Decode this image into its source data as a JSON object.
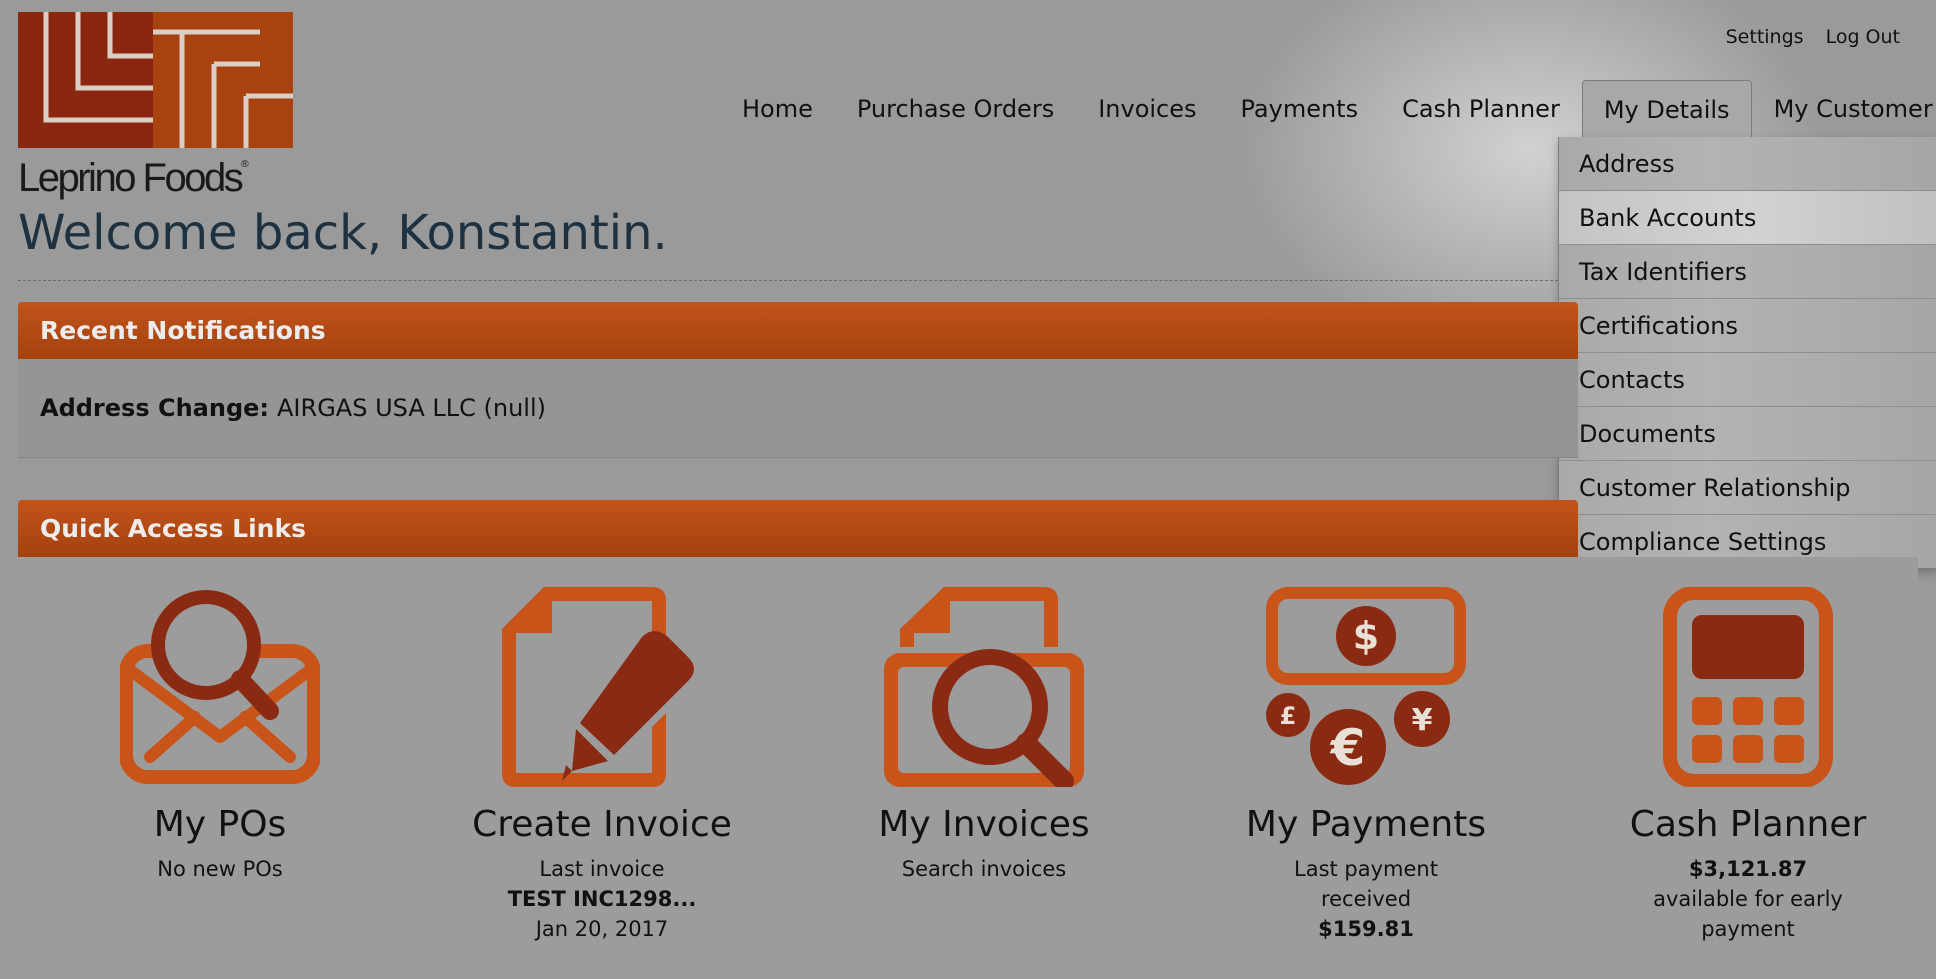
{
  "brand": {
    "name": "Leprino Foods",
    "mark": "®"
  },
  "util_nav": {
    "settings": "Settings",
    "logout": "Log Out"
  },
  "main_nav": [
    {
      "label": "Home"
    },
    {
      "label": "Purchase Orders"
    },
    {
      "label": "Invoices"
    },
    {
      "label": "Payments"
    },
    {
      "label": "Cash Planner"
    },
    {
      "label": "My Details"
    },
    {
      "label": "My Customer"
    }
  ],
  "dropdown": [
    {
      "label": "Address"
    },
    {
      "label": "Bank Accounts"
    },
    {
      "label": "Tax Identifiers"
    },
    {
      "label": "Certifications"
    },
    {
      "label": "Contacts"
    },
    {
      "label": "Documents"
    },
    {
      "label": "Customer Relationship"
    },
    {
      "label": "Compliance Settings"
    }
  ],
  "welcome": "Welcome back, Konstantin.",
  "notifications": {
    "title": "Recent Notifications",
    "label": "Address Change:",
    "text": "AIRGAS USA LLC (null)"
  },
  "quick_links": {
    "title": "Quick Access Links",
    "items": [
      {
        "icon": "envelope-search-icon",
        "title": "My POs",
        "sub1": "No new POs"
      },
      {
        "icon": "document-pencil-icon",
        "title": "Create Invoice",
        "sub1": "Last invoice",
        "sub2": "TEST INC1298...",
        "sub3": "Jan 20, 2017"
      },
      {
        "icon": "folder-search-icon",
        "title": "My Invoices",
        "sub1": "Search invoices"
      },
      {
        "icon": "currency-icon",
        "title": "My Payments",
        "sub1": "Last payment",
        "sub1b": "received",
        "sub2": "$159.81"
      },
      {
        "icon": "calculator-icon",
        "title": "Cash Planner",
        "sub2": "$3,121.87",
        "sub1": "available for early",
        "sub1b": "payment"
      }
    ]
  },
  "colors": {
    "accent_orange": "#c2531a",
    "icon_orange": "#c85419",
    "icon_dark": "#8b2a12",
    "logo_dark": "#8a2711",
    "logo_orange": "#a8420f"
  }
}
